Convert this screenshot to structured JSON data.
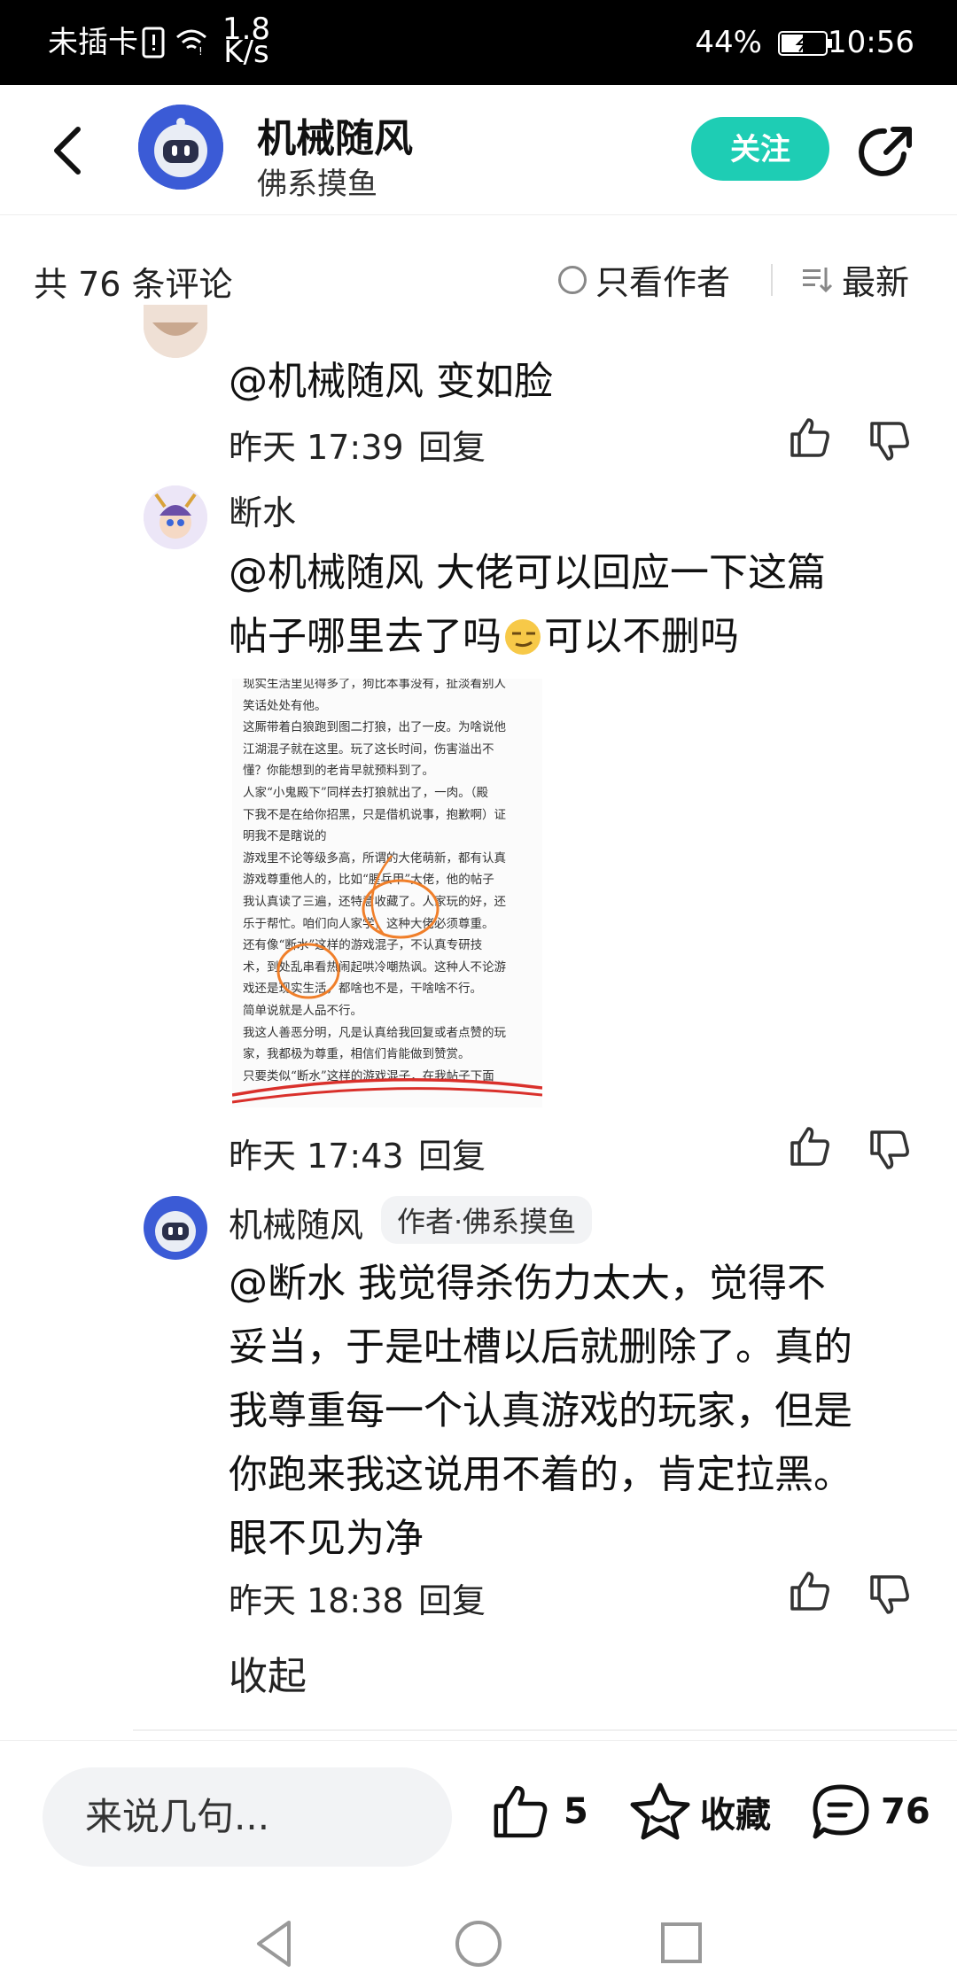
{
  "status_bar": {
    "carrier": "未插卡",
    "speed_value": "1.8",
    "speed_unit": "K/s",
    "battery": "44%",
    "time": "10:56"
  },
  "header": {
    "author_name": "机械随风",
    "author_subtitle": "佛系摸鱼",
    "follow_label": "关注"
  },
  "comment_bar": {
    "count_label": "共 76 条评论",
    "only_author_label": "只看作者",
    "sort_label": "最新"
  },
  "comments": [
    {
      "text": "@机械随风  变如脸",
      "time": "昨天 17:39",
      "reply_label": "回复"
    },
    {
      "author": "断水",
      "text_line1": "@机械随风  大佬可以回应一下这篇",
      "text_line2_a": "帖子哪里去了吗",
      "text_line2_b": "可以不删吗",
      "time": "昨天 17:43",
      "reply_label": "回复",
      "image_lines": [
        "现实生活里见得多了，狗比本事没有，扯淡看别人",
        "笑话处处有他。",
        "这厮带着白狼跑到图二打狼，出了一皮。为啥说他",
        "江湖混子就在这里。玩了这长时间，伤害溢出不",
        "懂？你能想到的老肯早就预料到了。",
        "人家“小鬼殿下”同样去打狼就出了，一肉。（殿",
        "下我不是在给你招黑，只是借机说事，抱歉啊）证",
        "明我不是瞎说的",
        "游戏里不论等级多高，所谓的大佬萌新，都有认真",
        "游戏尊重他人的，比如“腥兵甲”大佬，他的帖子",
        "我认真读了三遍，还特意收藏了。人家玩的好，还",
        "乐于帮忙。咱们向人家学，这种大佬必须尊重。",
        "还有像“断水”这样的游戏混子，不认真专研技",
        "术，到处乱串看热闹起哄冷嘲热讽。这种人不论游",
        "戏还是现实生活，都啥也不是，干啥啥不行。",
        "简单说就是人品不行。",
        "我这人善恶分明，凡是认真给我回复或者点赞的玩",
        "家，我都极为尊重，相信们肯能做到赞赏。",
        "只要类似“断水”这样的游戏混子，在我帖子下面"
      ]
    },
    {
      "author": "机械随风",
      "badge": "作者·佛系摸鱼",
      "lines": [
        "@断水  我觉得杀伤力太大，觉得不",
        "妥当，于是吐槽以后就删除了。真的",
        "我尊重每一个认真游戏的玩家，但是",
        "你跑来我这说用不着的，肯定拉黑。",
        "眼不见为净"
      ],
      "time": "昨天 18:38",
      "reply_label": "回复"
    }
  ],
  "collapse_label": "收起",
  "bottom_bar": {
    "input_placeholder": "来说几句...",
    "like_count": "5",
    "collect_label": "收藏",
    "comment_count": "76"
  },
  "colors": {
    "accent": "#1ecdb4",
    "avatar_blue": "#3b5bd6",
    "annotation_orange": "#f07f2a",
    "annotation_red": "#d9302b"
  },
  "icons": {
    "back": "back-arrow-icon",
    "share": "share-icon",
    "like": "thumbs-up-icon",
    "dislike": "thumbs-down-icon",
    "collect": "star-icon",
    "comment": "comment-bubble-icon"
  }
}
